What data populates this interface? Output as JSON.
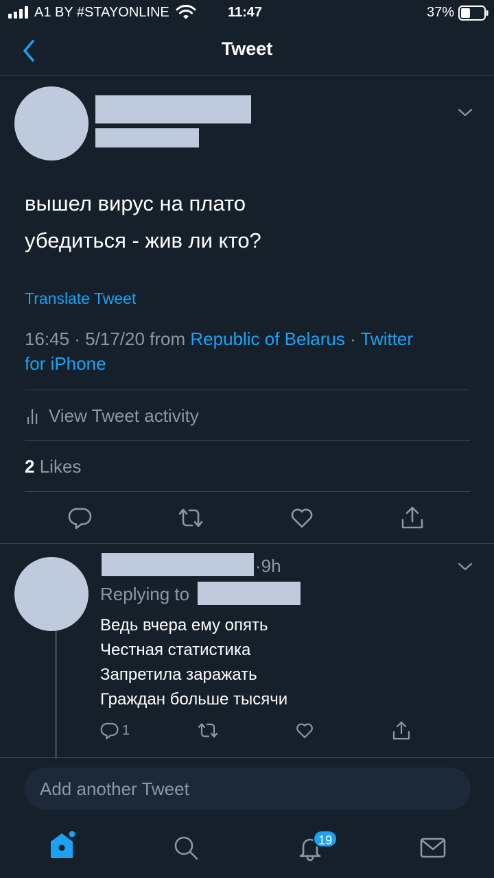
{
  "status_bar": {
    "carrier": "A1 BY #STAYONLINE",
    "time": "11:47",
    "battery": "37%"
  },
  "header": {
    "title": "Tweet",
    "back_icon": "chevron-left-icon"
  },
  "tweet": {
    "text_line1": "вышел вирус на плато",
    "text_line2": "убедиться - жив ли кто?",
    "translate_label": "Translate Tweet",
    "timestamp": "16:45 · 5/17/20 from ",
    "location": "Republic of Belarus",
    "separator": " · ",
    "source_part1": "Twitter",
    "source_part2": "for iPhone",
    "activity_label": "View Tweet activity",
    "likes_count": "2",
    "likes_label": "Likes"
  },
  "reply": {
    "time": "·9h",
    "replying_to_label": "Replying to",
    "line1": "Ведь вчера ему опять",
    "line2": "Честная статистика",
    "line3": "Запретила заражать",
    "line4": "Граждан больше тысячи",
    "reply_count": "1"
  },
  "compose": {
    "placeholder": "Add another Tweet"
  },
  "tab_bar": {
    "notifications_badge": "19"
  },
  "colors": {
    "background": "#15202b",
    "accent": "#1da1f2",
    "secondary_text": "#8899a6",
    "divider": "#38444d"
  }
}
